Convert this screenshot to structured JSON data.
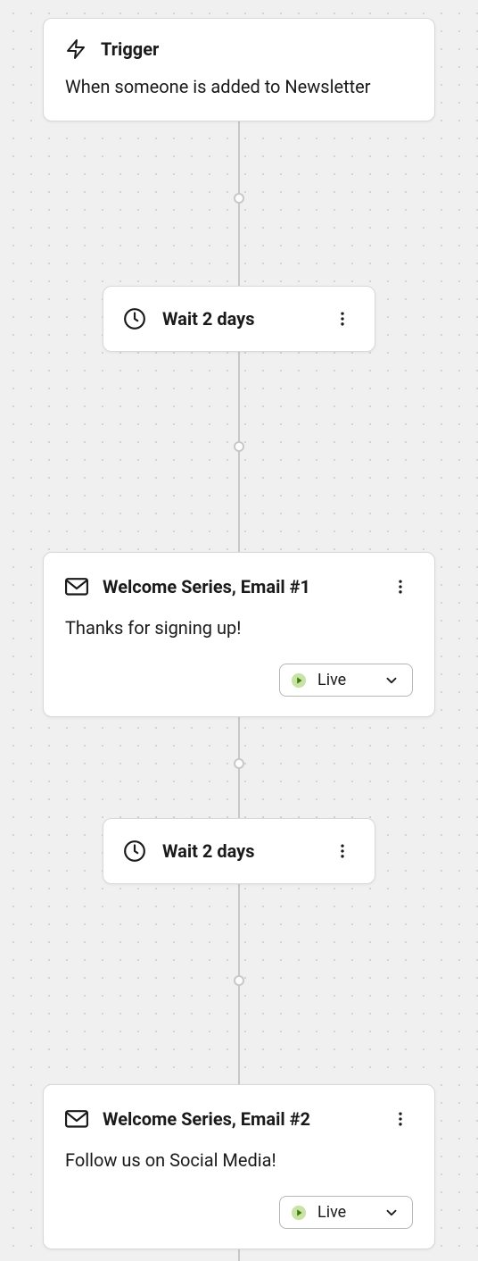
{
  "trigger": {
    "title": "Trigger",
    "description": "When someone is added to Newsletter"
  },
  "steps": {
    "wait1": {
      "label": "Wait 2 days"
    },
    "email1": {
      "title": "Welcome Series, Email #1",
      "description": "Thanks for signing up!",
      "status": "Live"
    },
    "wait2": {
      "label": "Wait 2 days"
    },
    "email2": {
      "title": "Welcome Series, Email #2",
      "description": "Follow us on Social Media!",
      "status": "Live"
    }
  }
}
